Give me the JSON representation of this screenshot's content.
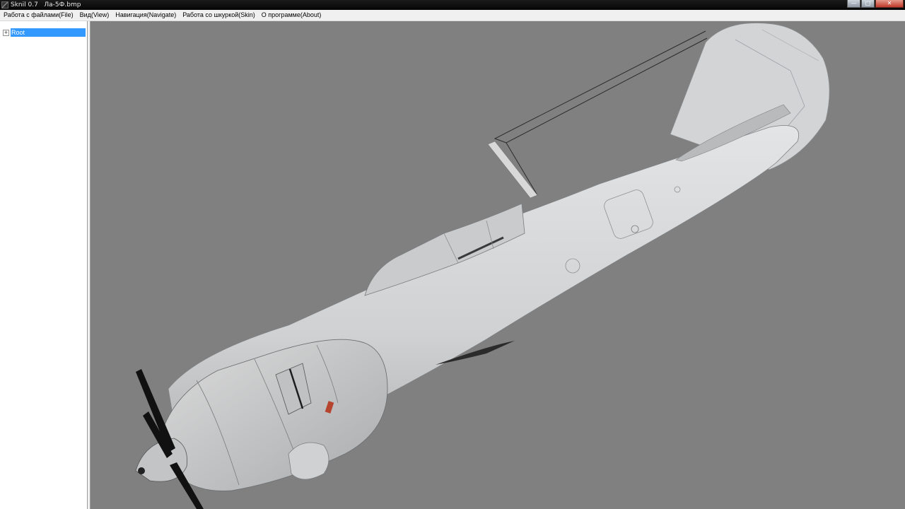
{
  "window": {
    "title": "Sknil 0.7   Ла-5Ф.bmp",
    "buttons": {
      "minimize": "—",
      "maximize": "□",
      "close": "✕"
    }
  },
  "menu": {
    "items": [
      "Работа с файлами(File)",
      "Вид(View)",
      "Навигация(Navigate)",
      "Работа со шкуркой(Skin)",
      "О программе(About)"
    ]
  },
  "tree": {
    "root_label": "Root",
    "expander": "+"
  },
  "viewport": {
    "background": "#808080",
    "model_color": "#d4d6d8",
    "icons": [
      "aircraft-model"
    ]
  }
}
